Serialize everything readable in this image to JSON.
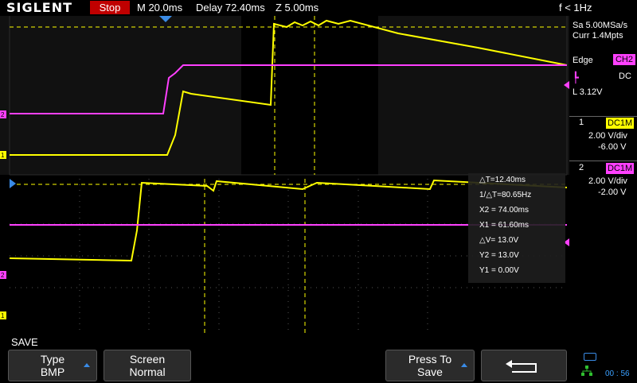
{
  "header": {
    "brand": "SIGLENT",
    "run_state": "Stop",
    "timebase": "M 20.0ms",
    "delay": "Delay 72.40ms",
    "zoom": "Z 5.00ms",
    "freq": "f < 1Hz"
  },
  "acquisition": {
    "sample_rate": "Sa 5.00MSa/s",
    "memory": "Curr 1.4Mpts"
  },
  "trigger": {
    "mode": "Edge",
    "source": "CH2",
    "coupling": "DC",
    "level": "L 3.12V"
  },
  "channels": [
    {
      "number": "1",
      "coupling": "DC1M",
      "vdiv": "2.00 V/div",
      "offset": "-6.00 V",
      "color": "#ffff00"
    },
    {
      "number": "2",
      "coupling": "DC1M",
      "vdiv": "2.00 V/div",
      "offset": "-2.00 V",
      "color": "#ff40ff"
    }
  ],
  "measurements": [
    "△T=12.40ms",
    "1/△T=80.65Hz",
    "X2 = 74.00ms",
    "X1 = 61.60ms",
    "△V= 13.0V",
    "Y2 = 13.0V",
    "Y1 = 0.00V"
  ],
  "menu": {
    "title": "SAVE",
    "type_label": "Type",
    "type_value": "BMP",
    "screen_label": "Screen",
    "screen_value": "Normal",
    "press_label": "Press To",
    "press_value": "Save"
  },
  "clock": "00 : 56",
  "markers": {
    "ch1": "1",
    "ch2": "2"
  },
  "colors": {
    "ch1": "#ffff00",
    "ch2": "#ff40ff",
    "accent": "#3a8be6",
    "stop": "#c00000"
  }
}
